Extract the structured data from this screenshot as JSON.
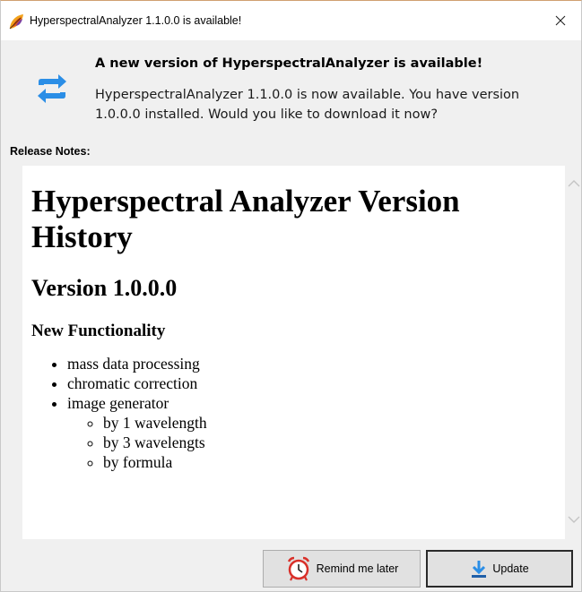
{
  "window": {
    "title": "HyperspectralAnalyzer 1.1.0.0 is available!"
  },
  "dialog": {
    "heading": "A new version of HyperspectralAnalyzer is available!",
    "description": "HyperspectralAnalyzer 1.1.0.0 is now available. You have version 1.0.0.0 installed. Would you like to download it now?",
    "release_notes_label": "Release Notes:"
  },
  "release_notes": {
    "title": "Hyperspectral Analyzer Version History",
    "version_heading": "Version 1.0.0.0",
    "section_heading": "New Functionality",
    "items": [
      "mass data processing",
      "chromatic correction",
      "image generator"
    ],
    "subitems": [
      "by 1 wavelength",
      "by 3 wavelengts",
      "by formula"
    ]
  },
  "buttons": {
    "remind_label": "Remind me later",
    "update_label": "Update"
  },
  "icons": {
    "app": "leaf-app-icon",
    "update": "sync-arrows-icon",
    "remind": "alarm-clock-icon",
    "download": "download-arrow-icon"
  },
  "colors": {
    "accent_blue": "#2b8ee6",
    "alarm_red": "#d9302a"
  }
}
